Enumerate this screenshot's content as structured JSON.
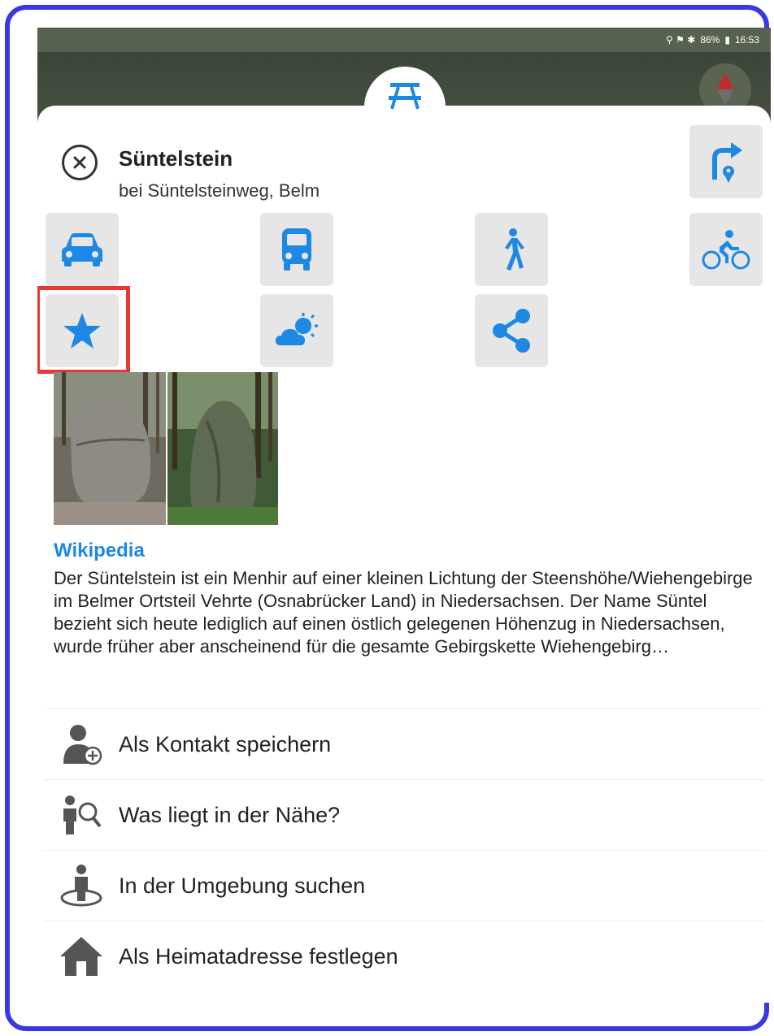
{
  "status_bar": {
    "battery": "86%",
    "time": "16:53"
  },
  "place": {
    "title": "Süntelstein",
    "subtitle": "bei Süntelsteinweg, Belm"
  },
  "icons": {
    "close": "close-icon",
    "route": "route-turn-icon",
    "car": "car-icon",
    "bus": "bus-icon",
    "walk": "walk-icon",
    "bike": "bicycle-icon",
    "favorite": "star-icon",
    "weather": "weather-icon",
    "share": "share-icon",
    "poi": "picnic-table-icon",
    "compass": "compass-icon"
  },
  "colors": {
    "accent": "#1e88e5",
    "highlight": "#e53935",
    "frame": "#3a37e6",
    "button_bg": "#e6e6e6"
  },
  "wikipedia": {
    "label": "Wikipedia",
    "text": "Der Süntelstein ist ein Menhir auf einer kleinen Lichtung der Steenshöhe/Wiehengebirge im Belmer Ortsteil Vehrte (Osnabrücker Land) in Niedersachsen. Der Name Süntel bezieht sich heute lediglich auf einen östlich gelegenen Höhenzug in Niedersachsen, wurde früher aber anscheinend für die gesamte Gebirgskette Wiehengebirg…"
  },
  "menu": [
    {
      "label": "Als Kontakt speichern",
      "icon": "add-contact-icon"
    },
    {
      "label": "Was liegt in der Nähe?",
      "icon": "nearby-search-icon"
    },
    {
      "label": "In der Umgebung suchen",
      "icon": "surroundings-icon"
    },
    {
      "label": "Als Heimatadresse festlegen",
      "icon": "home-icon"
    }
  ]
}
